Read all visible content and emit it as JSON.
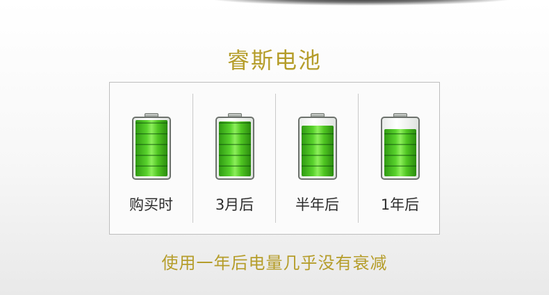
{
  "title": "睿斯电池",
  "caption": "使用一年后电量几乎没有衰减",
  "colors": {
    "accent_gold": "#b59d2a",
    "battery_green": "#4fc522",
    "label_text": "#2d2d2d"
  },
  "batteries": [
    {
      "label": "购买时",
      "charge_fraction": 1.0
    },
    {
      "label": "3月后",
      "charge_fraction": 0.97
    },
    {
      "label": "半年后",
      "charge_fraction": 0.9
    },
    {
      "label": "1年后",
      "charge_fraction": 0.84
    }
  ]
}
